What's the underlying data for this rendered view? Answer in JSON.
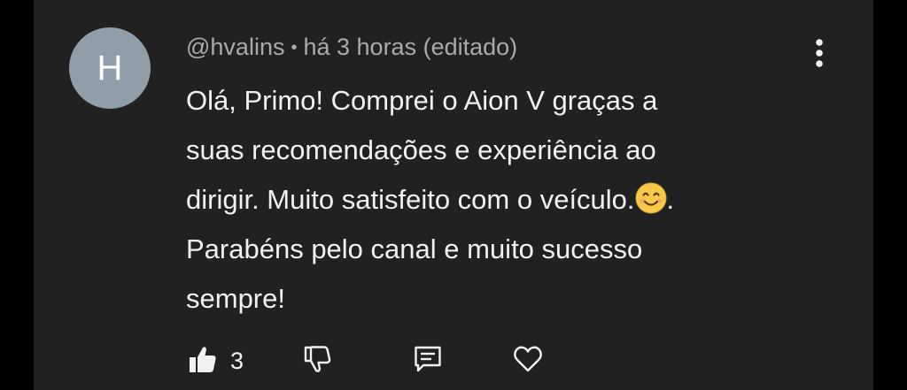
{
  "comment": {
    "avatar_letter": "H",
    "author": "@hvalins",
    "separator": "•",
    "time": "há 3 horas",
    "edited": "(editado)",
    "text_before_emoji": "Olá, Primo! Comprei o Aion V graças a\nsuas recomendações e experiência ao\ndirigir. Muito satisfeito com o veículo.",
    "emoji_name": "smiling-face-emoji",
    "text_after_emoji": ".\nParabéns pelo canal e muito sucesso\nsempre!"
  },
  "actions": {
    "like_count": "3",
    "like_icon": "thumbs-up-icon",
    "dislike_icon": "thumbs-down-icon",
    "reply_icon": "reply-comment-icon",
    "heart_icon": "heart-icon",
    "more_icon": "more-vertical-icon"
  },
  "colors": {
    "background": "#212121",
    "avatar": "#8f9ea8",
    "text": "#f1f1f1",
    "meta": "#aaaaaa"
  }
}
